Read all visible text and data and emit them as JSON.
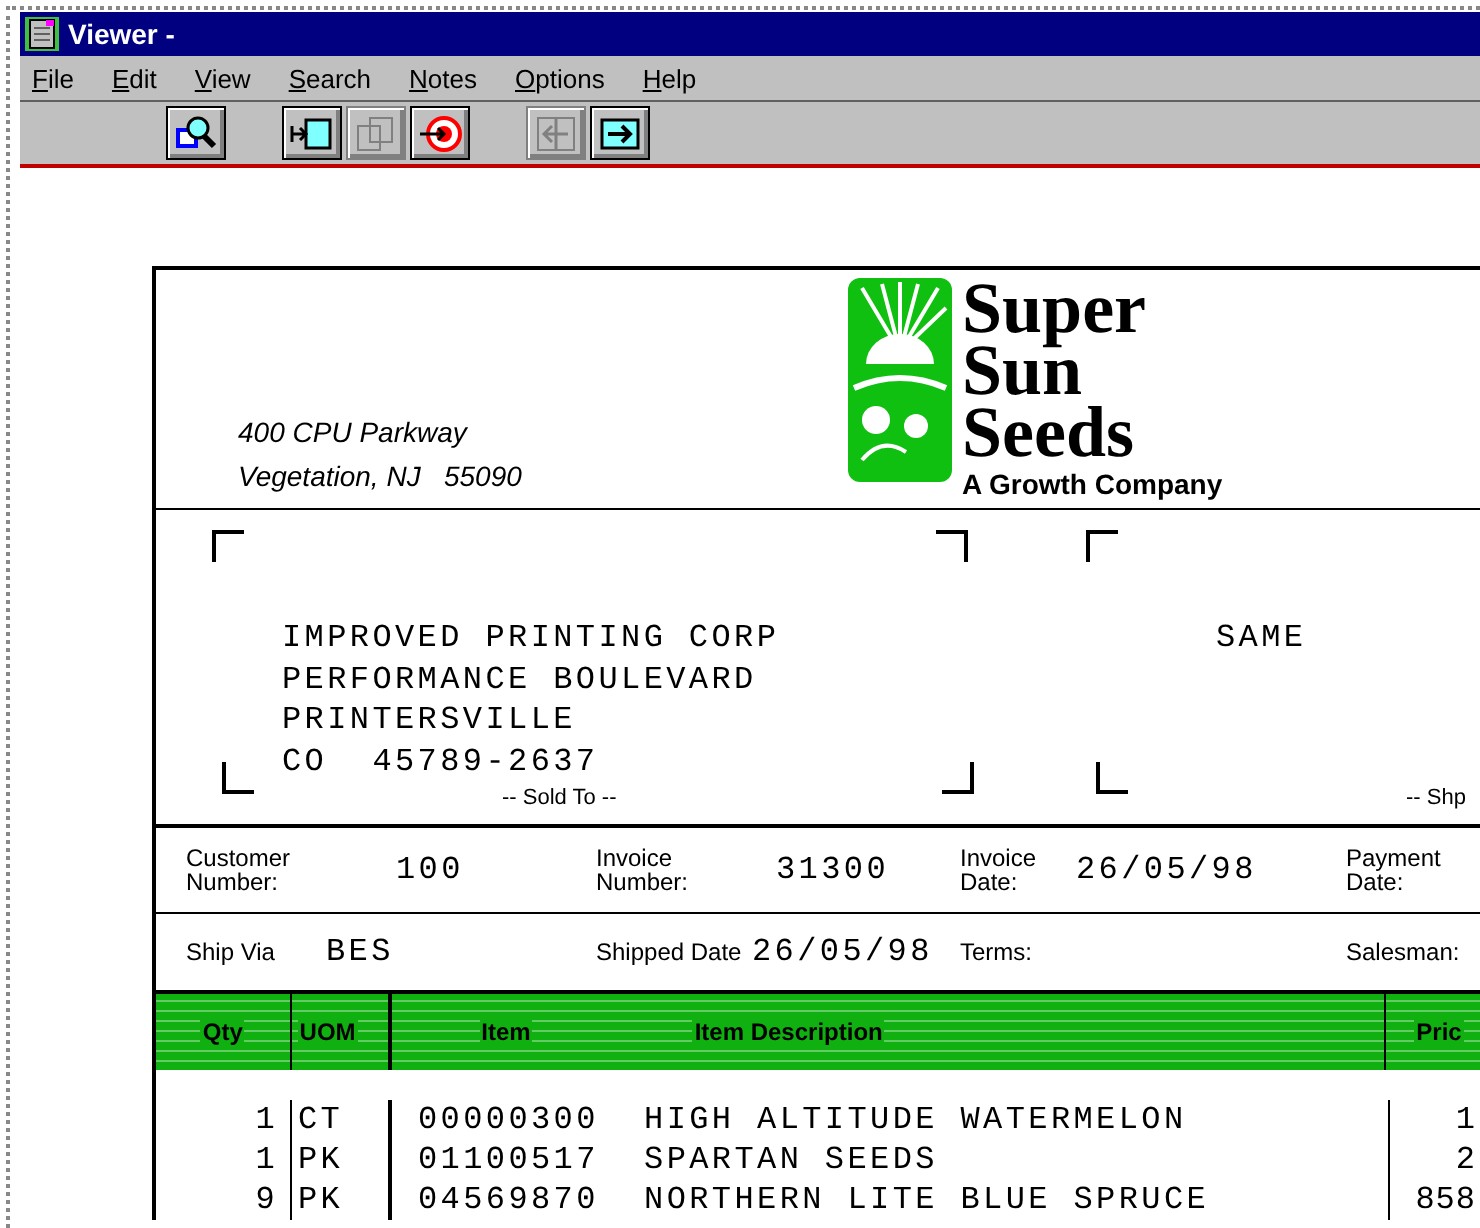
{
  "window": {
    "title": "Viewer -"
  },
  "menu": [
    "File",
    "Edit",
    "View",
    "Search",
    "Notes",
    "Options",
    "Help"
  ],
  "toolbar": [
    [
      {
        "kind": "zoom",
        "disabled": false
      }
    ],
    [
      {
        "kind": "import",
        "disabled": false
      },
      {
        "kind": "pages",
        "disabled": true
      },
      {
        "kind": "target",
        "disabled": false
      }
    ],
    [
      {
        "kind": "back",
        "disabled": true
      },
      {
        "kind": "forward",
        "disabled": false
      }
    ]
  ],
  "document": {
    "return_address": [
      "400 CPU Parkway",
      "Vegetation, NJ   55090"
    ],
    "logo": {
      "name_lines": [
        "Super",
        "Sun",
        "Seeds"
      ],
      "tagline": "A Growth Company"
    },
    "sold_to": {
      "lines": [
        "IMPROVED PRINTING CORP",
        "PERFORMANCE BOULEVARD",
        "PRINTERSVILLE",
        "CO  45789-2637"
      ],
      "caption": "-- Sold To --"
    },
    "ship_to": {
      "lines": [
        "SAME"
      ],
      "caption": "-- Shp"
    },
    "info_fields": [
      {
        "label": "Customer\nNumber:",
        "value": "100"
      },
      {
        "label": "Invoice\nNumber:",
        "value": "31300"
      },
      {
        "label": "Invoice\nDate:",
        "value": "26/05/98"
      },
      {
        "label": "Payment\nDate:"
      }
    ],
    "ship_fields": [
      {
        "label": "Ship Via",
        "value": "BES"
      },
      {
        "label": "Shipped Date",
        "value": "26/05/98"
      },
      {
        "label": "Terms:"
      },
      {
        "label": "Salesman:"
      }
    ],
    "table": {
      "columns": [
        {
          "label": "Qty"
        },
        {
          "label": "UOM"
        },
        {
          "label": "Item",
          "label_2": "Item Description"
        },
        {
          "label": "Pric"
        }
      ],
      "rows": [
        [
          "1",
          "CT",
          "00000300  HIGH ALTITUDE WATERMELON",
          "1"
        ],
        [
          "1",
          "PK",
          "01100517  SPARTAN SEEDS",
          "2"
        ],
        [
          "9",
          "PK",
          "04569870  NORTHERN LITE BLUE SPRUCE",
          "858"
        ]
      ]
    }
  }
}
